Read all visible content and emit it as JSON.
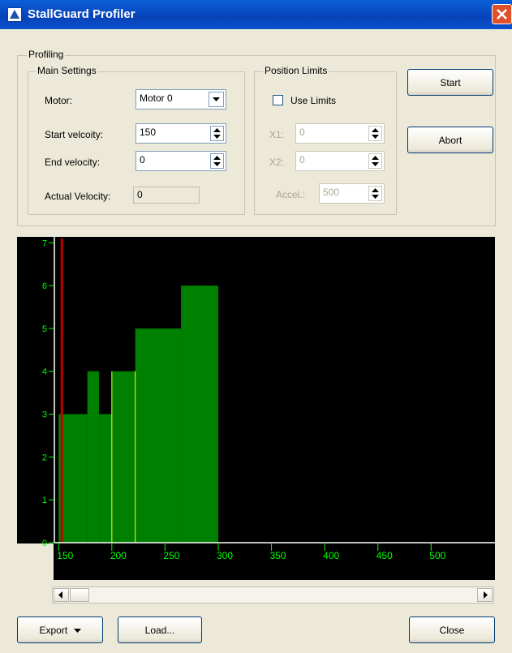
{
  "window": {
    "title": "StallGuard Profiler"
  },
  "profiling": {
    "group_label": "Profiling",
    "main_settings": {
      "label": "Main Settings",
      "motor_label": "Motor:",
      "motor_value": "Motor 0",
      "start_velocity_label": "Start velcoity:",
      "start_velocity_value": "150",
      "end_velocity_label": "End velocity:",
      "end_velocity_value": "0",
      "actual_velocity_label": "Actual Velocity:",
      "actual_velocity_value": "0"
    },
    "position_limits": {
      "label": "Position Limits",
      "use_limits_label": "Use Limits",
      "use_limits_checked": false,
      "x1_label": "X1:",
      "x1_value": "0",
      "x2_label": "X2:",
      "x2_value": "0",
      "accel_label": "Accel.:",
      "accel_value": "500"
    },
    "start_button": "Start",
    "abort_button": "Abort"
  },
  "chart_data": {
    "type": "bar",
    "bars": [
      {
        "x0": 150,
        "x1": 177,
        "y": 3
      },
      {
        "x0": 177,
        "x1": 188,
        "y": 4
      },
      {
        "x0": 188,
        "x1": 200,
        "y": 3
      },
      {
        "x0": 200,
        "x1": 222,
        "y": 4
      },
      {
        "x0": 222,
        "x1": 265,
        "y": 5
      },
      {
        "x0": 265,
        "x1": 300,
        "y": 6
      }
    ],
    "yellow_markers": [
      200,
      222
    ],
    "red_marker": 153,
    "xlim": [
      146,
      560
    ],
    "ylim": [
      0,
      7.1
    ],
    "yticks": [
      0,
      1,
      2,
      3,
      4,
      5,
      6,
      7
    ],
    "xticks": [
      150,
      200,
      250,
      300,
      350,
      400,
      450,
      500
    ],
    "colors": {
      "background": "#000000",
      "bar": "#008000",
      "axis": "#00ff00",
      "marker": "#ffff00",
      "red": "#c00000"
    }
  },
  "footer": {
    "export_button": "Export",
    "load_button": "Load...",
    "close_button": "Close"
  }
}
